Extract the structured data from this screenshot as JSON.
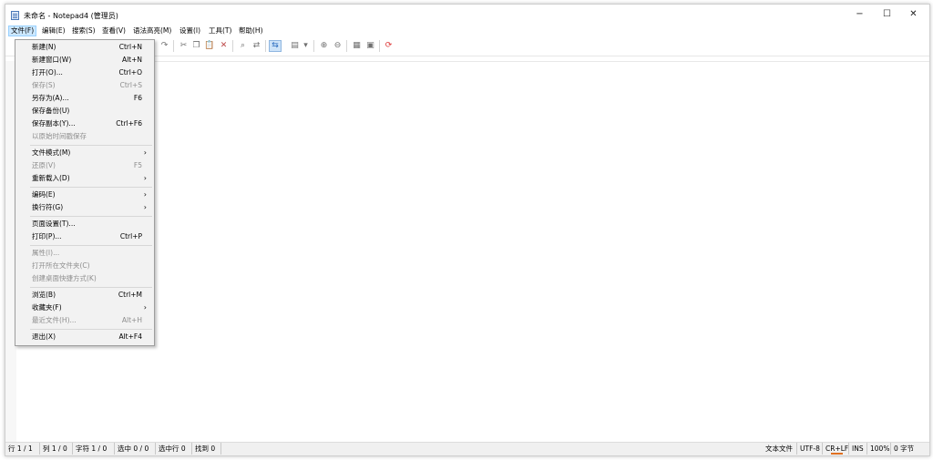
{
  "window": {
    "title": "未命名 - Notepad4 (管理员)",
    "min": "−",
    "max": "☐",
    "close": "✕"
  },
  "menubar": [
    "文件(F)",
    "编辑(E)",
    "搜索(S)",
    "查看(V)",
    "语法高亮(M)",
    "设置(I)",
    "工具(T)",
    "帮助(H)"
  ],
  "file_menu": [
    {
      "label": "新建(N)",
      "shortcut": "Ctrl+N",
      "disabled": false
    },
    {
      "label": "新建窗口(W)",
      "shortcut": "Alt+N",
      "disabled": false
    },
    {
      "label": "打开(O)...",
      "shortcut": "Ctrl+O",
      "disabled": false
    },
    {
      "label": "保存(S)",
      "shortcut": "Ctrl+S",
      "disabled": true
    },
    {
      "label": "另存为(A)...",
      "shortcut": "F6",
      "disabled": false
    },
    {
      "label": "保存备份(U)",
      "shortcut": "",
      "disabled": false
    },
    {
      "label": "保存副本(Y)...",
      "shortcut": "Ctrl+F6",
      "disabled": false
    },
    {
      "label": "以原始时间戳保存",
      "shortcut": "",
      "disabled": true
    },
    {
      "label": "文件模式(M)",
      "shortcut": "",
      "submenu": true,
      "disabled": false
    },
    {
      "label": "还原(V)",
      "shortcut": "F5",
      "disabled": true
    },
    {
      "label": "重新载入(D)",
      "shortcut": "",
      "submenu": true,
      "disabled": false
    },
    {
      "label": "编码(E)",
      "shortcut": "",
      "submenu": true,
      "disabled": false
    },
    {
      "label": "换行符(G)",
      "shortcut": "",
      "submenu": true,
      "disabled": false
    },
    {
      "label": "页面设置(T)...",
      "shortcut": "",
      "disabled": false
    },
    {
      "label": "打印(P)...",
      "shortcut": "Ctrl+P",
      "disabled": false
    },
    {
      "label": "属性(I)...",
      "shortcut": "",
      "disabled": true
    },
    {
      "label": "打开所在文件夹(C)",
      "shortcut": "",
      "disabled": true
    },
    {
      "label": "创建桌面快捷方式(K)",
      "shortcut": "",
      "disabled": true
    },
    {
      "label": "浏览(B)",
      "shortcut": "Ctrl+M",
      "disabled": false
    },
    {
      "label": "收藏夹(F)",
      "shortcut": "",
      "submenu": true,
      "disabled": false
    },
    {
      "label": "最近文件(H)...",
      "shortcut": "Alt+H",
      "disabled": true
    },
    {
      "label": "退出(X)",
      "shortcut": "Alt+F4",
      "disabled": false
    }
  ],
  "submenu_arrow": "›",
  "toolbar_icons": [
    "undo-icon",
    "redo-icon",
    "cut-icon",
    "copy-icon",
    "paste-icon",
    "delete-icon",
    "find-icon",
    "replace-icon",
    "word-wrap-icon",
    "scheme-icon",
    "dropdown-icon",
    "zoom-in-icon",
    "zoom-out-icon",
    "settings-icon",
    "favorites-icon",
    "exit-icon"
  ],
  "toolbar_glyphs": {
    "undo": "↶",
    "redo": "↷",
    "cut": "✂",
    "copy": "❐",
    "paste": "📋",
    "delete": "✕",
    "find": "⌕",
    "replace": "⇄",
    "wrap": "⇆",
    "scheme": "▤",
    "dd": "▾",
    "zoomin": "⊕",
    "zoomout": "⊖",
    "settings": "▦",
    "fav": "▣",
    "exit": "⟳"
  },
  "statusbar": {
    "line": "行 1 / 1",
    "col": "列 1 / 0",
    "char": "字符 1 / 0",
    "sel": "选中 0 / 0",
    "sel_lines": "选中行 0",
    "found": "找到 0",
    "lexer": "文本文件",
    "encoding": "UTF-8",
    "eol": "CR+LF",
    "ins": "INS",
    "zoom": "100%",
    "size": "0 字节"
  },
  "colors": {
    "menu_active": "#cce8ff",
    "toolbar_active": "#cde3f8",
    "disabled_text": "#8d8d8d",
    "eol_underline": "#e07020"
  }
}
